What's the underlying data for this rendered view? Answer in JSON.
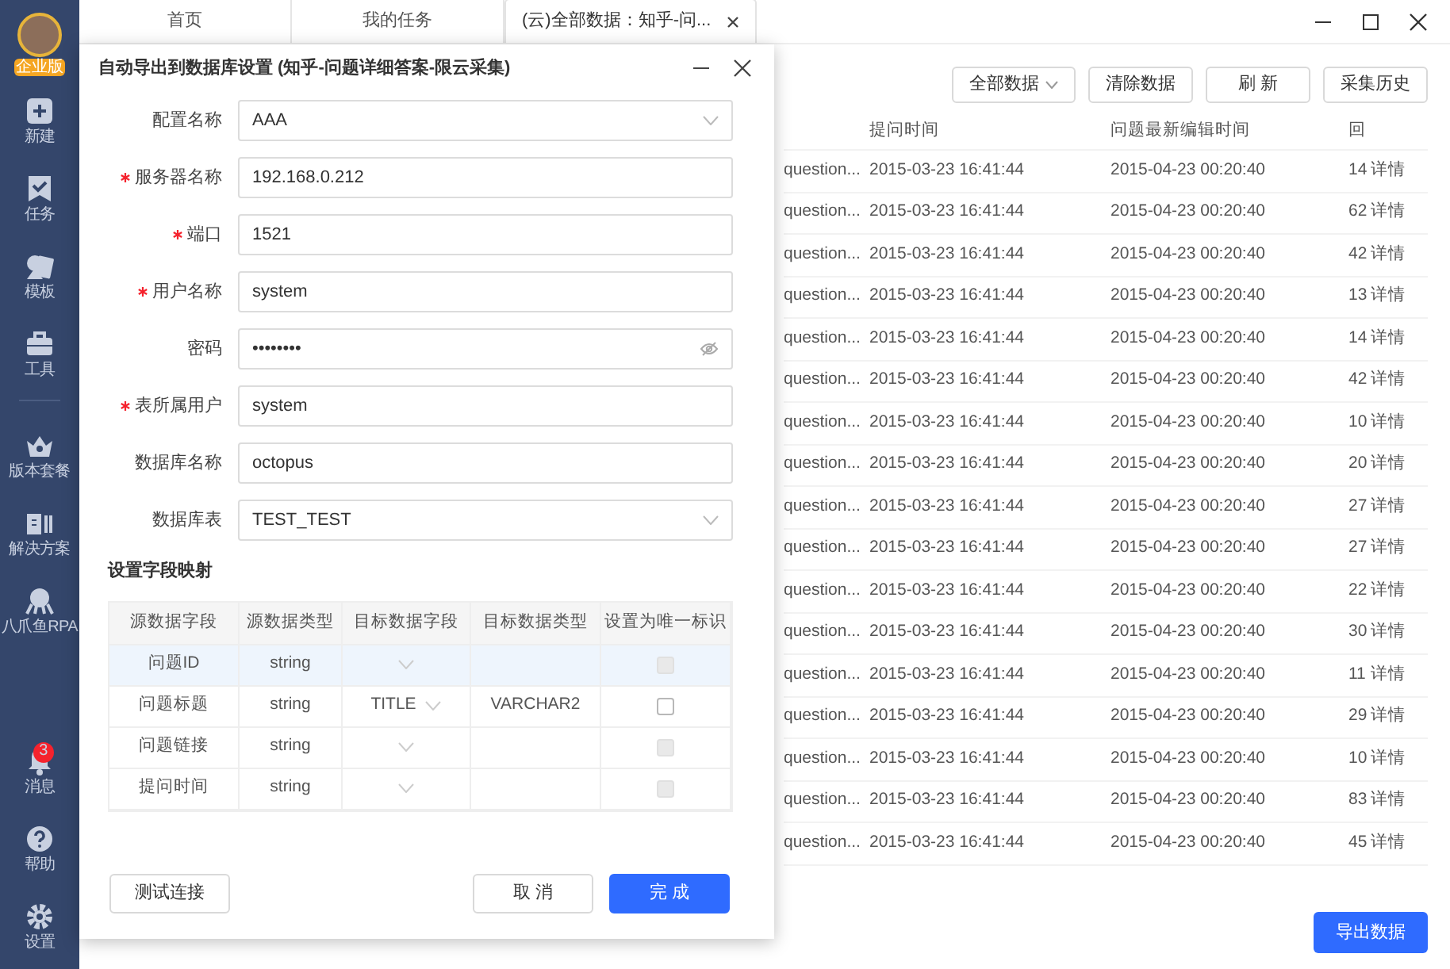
{
  "sidebar": {
    "avatar_badge": "企业版",
    "top": [
      {
        "kind": "plus",
        "label": "新建"
      },
      {
        "kind": "task",
        "label": "任务"
      },
      {
        "kind": "template",
        "label": "模板"
      },
      {
        "kind": "toolbox",
        "label": "工具"
      }
    ],
    "middle": [
      {
        "kind": "crown",
        "label": "版本套餐"
      },
      {
        "kind": "solution",
        "label": "解决方案"
      },
      {
        "kind": "octopus",
        "label": "八爪鱼RPA"
      }
    ],
    "bottom": [
      {
        "kind": "bell",
        "label": "消息",
        "count": "3"
      },
      {
        "kind": "help",
        "label": "帮助"
      },
      {
        "kind": "gear",
        "label": "设置"
      }
    ]
  },
  "tabs": [
    {
      "label": "首页",
      "selected": false,
      "closable": false
    },
    {
      "label": "我的任务",
      "selected": false,
      "closable": false
    },
    {
      "label": "(云)全部数据：知乎-问...",
      "selected": true,
      "closable": true
    }
  ],
  "toolbar": [
    {
      "kind": "dropdown",
      "label": "全部数据"
    },
    {
      "kind": "button",
      "label": "清除数据"
    },
    {
      "kind": "button",
      "label": "刷 新"
    },
    {
      "kind": "button",
      "label": "采集历史"
    }
  ],
  "data_table": {
    "header": {
      "time": "提问时间",
      "edited": "问题最新编辑时间",
      "column_4": "回"
    },
    "rows": [
      [
        "question...",
        "2015-03-23 16:41:44",
        "2015-04-23 00:20:40",
        "14",
        "详情"
      ],
      [
        "question...",
        "2015-03-23 16:41:44",
        "2015-04-23 00:20:40",
        "62",
        "详情"
      ],
      [
        "question...",
        "2015-03-23 16:41:44",
        "2015-04-23 00:20:40",
        "42",
        "详情"
      ],
      [
        "question...",
        "2015-03-23 16:41:44",
        "2015-04-23 00:20:40",
        "13",
        "详情"
      ],
      [
        "question...",
        "2015-03-23 16:41:44",
        "2015-04-23 00:20:40",
        "14",
        "详情"
      ],
      [
        "question...",
        "2015-03-23 16:41:44",
        "2015-04-23 00:20:40",
        "42",
        "详情"
      ],
      [
        "question...",
        "2015-03-23 16:41:44",
        "2015-04-23 00:20:40",
        "10",
        "详情"
      ],
      [
        "question...",
        "2015-03-23 16:41:44",
        "2015-04-23 00:20:40",
        "20",
        "详情"
      ],
      [
        "question...",
        "2015-03-23 16:41:44",
        "2015-04-23 00:20:40",
        "27",
        "详情"
      ],
      [
        "question...",
        "2015-03-23 16:41:44",
        "2015-04-23 00:20:40",
        "27",
        "详情"
      ],
      [
        "question...",
        "2015-03-23 16:41:44",
        "2015-04-23 00:20:40",
        "22",
        "详情"
      ],
      [
        "question...",
        "2015-03-23 16:41:44",
        "2015-04-23 00:20:40",
        "30",
        "详情"
      ],
      [
        "question...",
        "2015-03-23 16:41:44",
        "2015-04-23 00:20:40",
        "11",
        "详情"
      ],
      [
        "question...",
        "2015-03-23 16:41:44",
        "2015-04-23 00:20:40",
        "29",
        "详情"
      ],
      [
        "question...",
        "2015-03-23 16:41:44",
        "2015-04-23 00:20:40",
        "10",
        "详情"
      ],
      [
        "question...",
        "2015-03-23 16:41:44",
        "2015-04-23 00:20:40",
        "83",
        "详情"
      ],
      [
        "question...",
        "2015-03-23 16:41:44",
        "2015-04-23 00:20:40",
        "45",
        "详情"
      ]
    ]
  },
  "export_button": "导出数据",
  "dialog": {
    "title": "自动导出到数据库设置 (知乎-问题详细答案-限云采集)",
    "fields": [
      {
        "label": "配置名称",
        "required": false,
        "kind": "select",
        "value": "AAA"
      },
      {
        "label": "服务器名称",
        "required": true,
        "kind": "text",
        "value": "192.168.0.212"
      },
      {
        "label": "端口",
        "required": true,
        "kind": "text",
        "value": "1521"
      },
      {
        "label": "用户名称",
        "required": true,
        "kind": "text",
        "value": "system"
      },
      {
        "label": "密码",
        "required": false,
        "kind": "password",
        "value": "••••••••"
      },
      {
        "label": "表所属用户",
        "required": true,
        "kind": "text",
        "value": "system"
      },
      {
        "label": "数据库名称",
        "required": false,
        "kind": "text",
        "value": "octopus"
      },
      {
        "label": "数据库表",
        "required": false,
        "kind": "select",
        "value": "TEST_TEST"
      }
    ],
    "mapping_title": "设置字段映射",
    "mapping_columns": [
      "源数据字段",
      "源数据类型",
      "目标数据字段",
      "目标数据类型",
      "设置为唯一标识"
    ],
    "mapping_rows": [
      {
        "source": "问题ID",
        "source_type": "string",
        "target": null,
        "target_type": null,
        "unique": false,
        "unique_disabled": true,
        "selected": true
      },
      {
        "source": "问题标题",
        "source_type": "string",
        "target": "TITLE",
        "target_type": "VARCHAR2",
        "unique": false,
        "unique_disabled": false,
        "selected": false
      },
      {
        "source": "问题链接",
        "source_type": "string",
        "target": null,
        "target_type": null,
        "unique": false,
        "unique_disabled": true,
        "selected": false
      },
      {
        "source": "提问时间",
        "source_type": "string",
        "target": null,
        "target_type": null,
        "unique": false,
        "unique_disabled": true,
        "selected": false
      }
    ],
    "buttons": [
      {
        "kind": "secondary",
        "label": "测试连接"
      },
      {
        "kind": "secondary",
        "label": "取 消"
      },
      {
        "kind": "primary",
        "label": "完 成"
      }
    ]
  }
}
